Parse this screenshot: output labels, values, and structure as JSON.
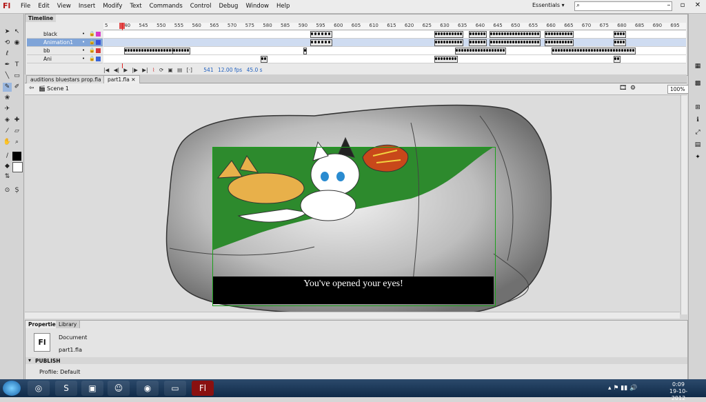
{
  "app": {
    "logo": "Fl"
  },
  "menu": [
    "File",
    "Edit",
    "View",
    "Insert",
    "Modify",
    "Text",
    "Commands",
    "Control",
    "Debug",
    "Window",
    "Help"
  ],
  "workspace": {
    "label": "Essentials",
    "arrow": "▾"
  },
  "search": {
    "placeholder": ""
  },
  "timeline": {
    "tab_label": "Timeline",
    "ruler_ticks": [
      "5",
      "540",
      "545",
      "550",
      "555",
      "560",
      "565",
      "570",
      "575",
      "580",
      "585",
      "590",
      "595",
      "600",
      "605",
      "610",
      "615",
      "620",
      "625",
      "630",
      "635",
      "640",
      "645",
      "650",
      "655",
      "660",
      "665",
      "670",
      "675",
      "680",
      "685",
      "690",
      "695"
    ],
    "layers": [
      {
        "name": "black",
        "color": "#d83ac8"
      },
      {
        "name": "Animation1",
        "color": "#3a55d8"
      },
      {
        "name": "bb",
        "color": "#d83a3a"
      },
      {
        "name": "Ani",
        "color": "#3a66d8"
      }
    ],
    "status": {
      "frame": "541",
      "fps": "12.00 fps",
      "time": "45.0 s"
    }
  },
  "doc_tabs": [
    "auditions bluestars prop.fla",
    "part1.fla"
  ],
  "scene": {
    "label": "Scene 1",
    "zoom": "100%"
  },
  "stage": {
    "caption": "You've opened your eyes!"
  },
  "properties": {
    "tabs": [
      "Properties",
      "Library"
    ],
    "doc_icon": "Fl",
    "doc_type": "Document",
    "doc_name": "part1.fla",
    "section": "PUBLISH",
    "profile_label": "Profile:",
    "profile_value": "Default"
  },
  "taskbar": {
    "time": "0:09",
    "date": "19-10-2012"
  },
  "colors": {
    "green_bg": "#2d8a2d",
    "stage_border": "#1aa01a",
    "fox": "#e8b04a",
    "squirrel": "#c8481a"
  }
}
